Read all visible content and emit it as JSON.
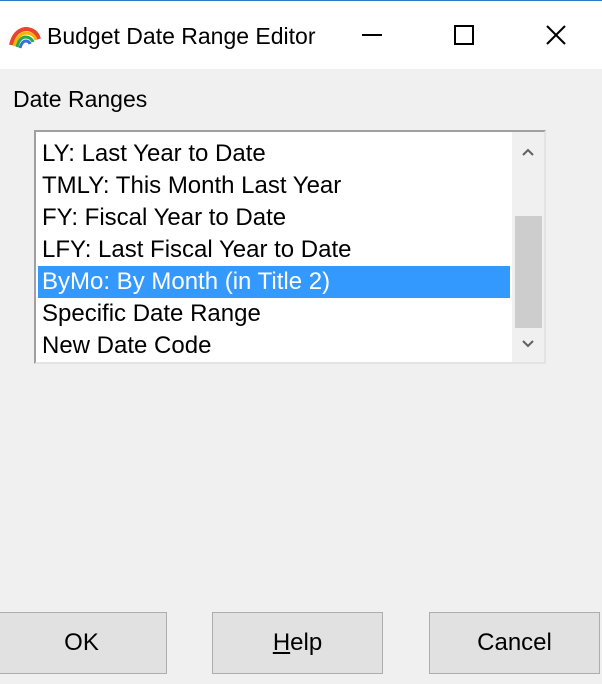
{
  "window": {
    "title": "Budget Date Range Editor",
    "icon": "rainbow-app-icon",
    "controls": [
      "minimize-icon",
      "maximize-icon",
      "close-icon"
    ]
  },
  "date_ranges": {
    "label": "Date Ranges",
    "items": [
      {
        "label": "LY: Last Year to Date",
        "selected": false
      },
      {
        "label": "TMLY: This Month Last Year",
        "selected": false
      },
      {
        "label": "FY: Fiscal Year to Date",
        "selected": false
      },
      {
        "label": "LFY: Last Fiscal Year to Date",
        "selected": false
      },
      {
        "label": "ByMo: By Month (in Title 2)",
        "selected": true
      },
      {
        "label": "Specific Date Range",
        "selected": false
      },
      {
        "label": "New Date Code",
        "selected": false
      }
    ],
    "selection_color": "#3399ff"
  },
  "buttons": {
    "ok": "OK",
    "help_mnemonic": "H",
    "help_rest": "elp",
    "cancel": "Cancel"
  }
}
